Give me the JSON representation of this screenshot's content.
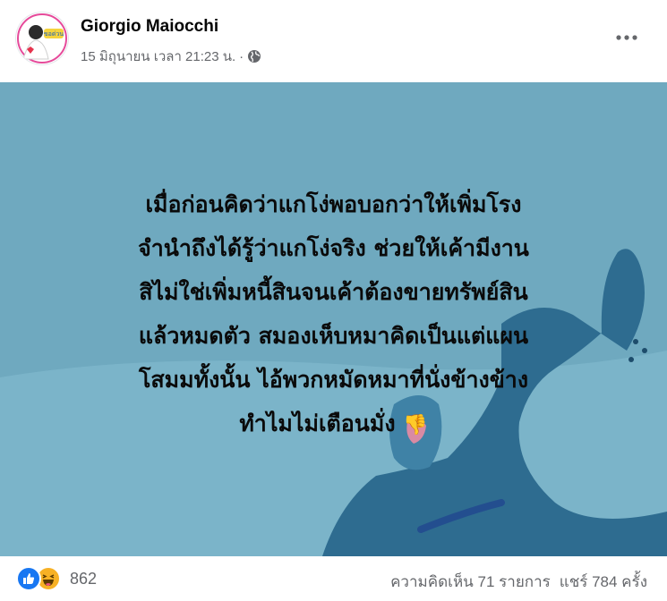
{
  "post": {
    "author": "Giorgio Maiocchi",
    "timestamp": "15 มิถุนายน เวลา 21:23 น.",
    "separator": "·",
    "privacy_icon": "globe-icon",
    "avatar_badge_text": "ขอด่วน",
    "lines": [
      "เมื่อก่อนคิดว่าแกโง่พอบอกว่าให้เพิ่มโรง",
      "จำนำถึงได้รู้ว่าแกโง่จริง ช่วยให้เค้ามีงาน",
      "สิไม่ใช่เพิ่มหนี้สินจนเค้าต้องขายทรัพย์สิน",
      "แล้วหมดตัว สมองเห็บหมาคิดเป็นแต่แผน",
      "โสมมทั้งนั้น ไอ้พวกหมัดหมาที่นั่งข้างข้าง",
      "ทำไมไม่เตือนมั่ง"
    ],
    "emoji": "👎",
    "background_color": "#6fa9bf",
    "accent_color": "#7ab8cc"
  },
  "footer": {
    "reaction_icons": [
      "like-icon",
      "haha-icon"
    ],
    "reaction_count": "862",
    "comments": "ความคิดเห็น 71 รายการ",
    "shares": "แชร์ 784 ครั้ง"
  }
}
